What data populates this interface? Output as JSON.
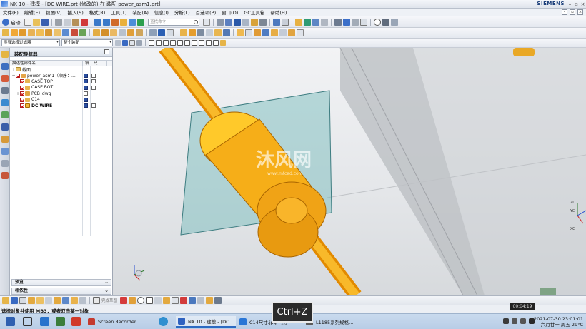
{
  "titlebar": {
    "title": "NX 10 - 建模 - [DC WIRE.prt  (修改的)   在 装配 power_asm1.prt]",
    "brand": "SIEMENS"
  },
  "menu": [
    "文件(F)",
    "编辑(E)",
    "视图(V)",
    "插入(S)",
    "格式(R)",
    "工具(T)",
    "装配(A)",
    "信息(I)",
    "分析(L)",
    "首选项(P)",
    "窗口(O)",
    "GC工具箱",
    "帮助(H)"
  ],
  "toolbar": {
    "start_label": "启动·",
    "search_placeholder": "查找命令"
  },
  "selection_bar": {
    "filter": "没有选择过滤器",
    "scope": "整个装配"
  },
  "navigator": {
    "title": "装配导航器",
    "columns": [
      "描述性部件名",
      "填...",
      "只..."
    ],
    "items": [
      {
        "indent": 0,
        "expander": "+",
        "label": "截面",
        "kind": "folder"
      },
      {
        "indent": 0,
        "expander": "−",
        "label": "power_asm1（顺序：...",
        "kind": "asm"
      },
      {
        "indent": 1,
        "expander": "",
        "label": "CASE TOP",
        "kind": "part"
      },
      {
        "indent": 1,
        "expander": "",
        "label": "CASE BOT",
        "kind": "part"
      },
      {
        "indent": 1,
        "expander": "+",
        "label": "PCB_dwg",
        "kind": "part"
      },
      {
        "indent": 1,
        "expander": "",
        "label": "C14",
        "kind": "part"
      },
      {
        "indent": 1,
        "expander": "",
        "label": "DC WIRE",
        "kind": "part-active"
      }
    ],
    "sections": [
      "预览",
      "相依性"
    ]
  },
  "viewport": {
    "triad_labels": [
      "ZC",
      "YC",
      "XC"
    ],
    "watermark_main": "沐风网",
    "watermark_sub": "www.mfcad.com"
  },
  "bottom_toolbar": {
    "snap_label": "完成草图"
  },
  "status_text": "选择对象并使用 MB3，或者双击某一对象",
  "sys_note": "00:04:19",
  "taskbar": {
    "apps": [
      {
        "label": "Screen Recorder",
        "color": "#c43a2f"
      },
      {
        "label": "NX 10 - 建模 - [DC...",
        "color": "#2f62c0"
      },
      {
        "label": "C14尺寸.jpg - 照片",
        "color": "#2a76d6"
      },
      {
        "label": "L1185系列规格...",
        "color": "#5b5b5b"
      }
    ],
    "clock_time": "2021-07-30 23:01:01",
    "clock_date": "六月廿一   周五 29°C"
  },
  "overlay_key": "Ctrl+Z"
}
